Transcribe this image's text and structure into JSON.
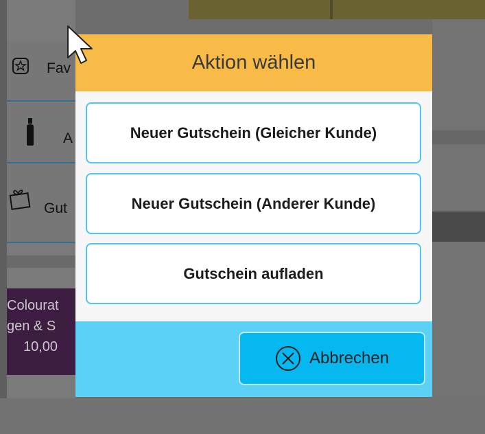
{
  "background": {
    "tiles": [
      {
        "label": "Fav",
        "icon": "star-icon"
      },
      {
        "label": "A",
        "icon": "bottle-icon"
      },
      {
        "label": "Gut",
        "icon": "gift-icon"
      }
    ],
    "product": {
      "line1": "Colourat",
      "line2": "gen & S",
      "price": "10,00"
    }
  },
  "dialog": {
    "title": "Aktion wählen",
    "options": [
      "Neuer Gutschein  (Gleicher Kunde)",
      "Neuer Gutschein (Anderer Kunde)",
      "Gutschein aufladen"
    ],
    "cancel_label": "Abbrechen",
    "cancel_icon": "close-circle-icon"
  },
  "colors": {
    "header": "#f8bb48",
    "footer": "#5ad1f5",
    "cancel": "#05b8ef",
    "option_border": "#4cc8f0"
  }
}
